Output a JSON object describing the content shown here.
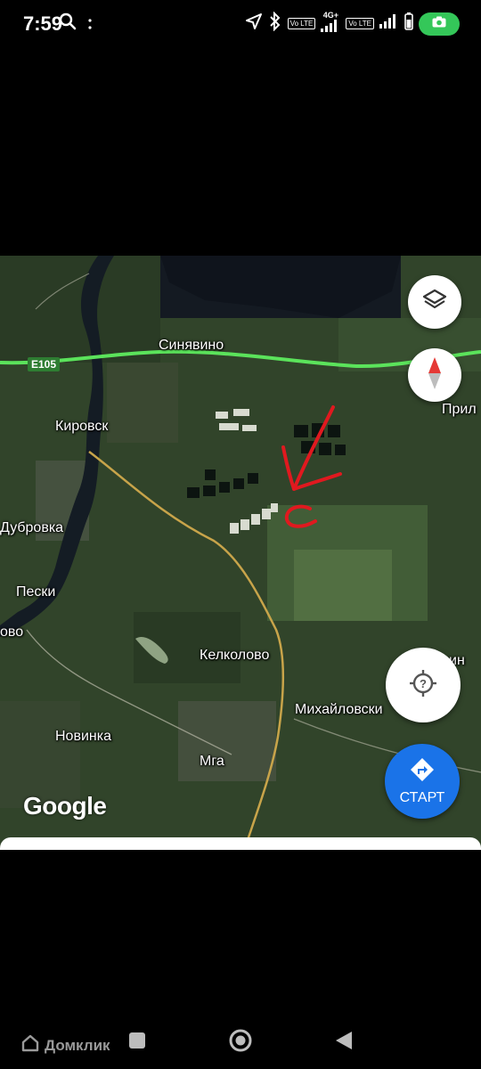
{
  "status_bar": {
    "time": "7:59",
    "network_1": "4G+",
    "volte_label": "Vo LTE",
    "icons": [
      "search-icon",
      "more-dots-icon",
      "location-arrow-icon",
      "bluetooth-icon",
      "signal-icon",
      "battery-icon",
      "camera-icon"
    ]
  },
  "map": {
    "places": {
      "sinyavino": "Синявино",
      "kirovsk": "Кировск",
      "dubrovka": "Дубровка",
      "peski": "Пески",
      "ovo": "ово",
      "kelkolovo": "Келколово",
      "mikhailovsky": "Михайловски",
      "novinka": "Новинка",
      "mga": "Мга",
      "pril": "Прил",
      "in": "ин"
    },
    "road_shield": "E105",
    "logo": "Google",
    "start_label": "СТАРТ",
    "accent_color": "#1a73e8",
    "annotation_color": "#e0191f"
  },
  "nav": {
    "watermark": "Домклик"
  }
}
